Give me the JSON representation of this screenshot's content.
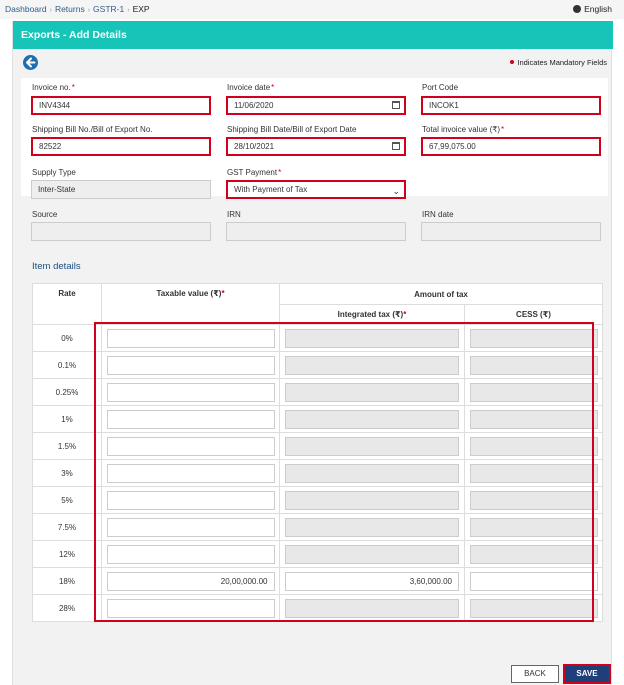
{
  "breadcrumb": {
    "items": [
      "Dashboard",
      "Returns",
      "GSTR-1"
    ],
    "current": "EXP"
  },
  "language": "English",
  "header": {
    "title": "Exports - Add Details"
  },
  "mandatory_note": "Indicates Mandatory Fields",
  "form": {
    "invoice_no": {
      "label": "Invoice no.",
      "value": "INV4344"
    },
    "invoice_date": {
      "label": "Invoice date",
      "value": "11/06/2020"
    },
    "port_code": {
      "label": "Port Code",
      "value": "INCOK1"
    },
    "shipping_bill_no": {
      "label": "Shipping Bill No./Bill of Export No.",
      "value": "82522"
    },
    "shipping_bill_date": {
      "label": "Shipping Bill Date/Bill of Export Date",
      "value": "28/10/2021"
    },
    "total_invoice_value": {
      "label": "Total invoice value (₹)",
      "value": "67,99,075.00"
    },
    "supply_type": {
      "label": "Supply Type",
      "value": "Inter-State"
    },
    "gst_payment": {
      "label": "GST Payment",
      "value": "With Payment of Tax"
    },
    "source": {
      "label": "Source",
      "value": ""
    },
    "irn": {
      "label": "IRN",
      "value": ""
    },
    "irn_date": {
      "label": "IRN date",
      "value": ""
    }
  },
  "items": {
    "title": "Item details",
    "headers": {
      "rate": "Rate",
      "taxable": "Taxable value (₹)",
      "amount_of_tax": "Amount of tax",
      "igst": "Integrated tax (₹)",
      "cess": "CESS (₹)"
    },
    "rows": [
      {
        "rate": "0%",
        "taxable": "",
        "igst": "",
        "cess": ""
      },
      {
        "rate": "0.1%",
        "taxable": "",
        "igst": "",
        "cess": ""
      },
      {
        "rate": "0.25%",
        "taxable": "",
        "igst": "",
        "cess": ""
      },
      {
        "rate": "1%",
        "taxable": "",
        "igst": "",
        "cess": ""
      },
      {
        "rate": "1.5%",
        "taxable": "",
        "igst": "",
        "cess": ""
      },
      {
        "rate": "3%",
        "taxable": "",
        "igst": "",
        "cess": ""
      },
      {
        "rate": "5%",
        "taxable": "",
        "igst": "",
        "cess": ""
      },
      {
        "rate": "7.5%",
        "taxable": "",
        "igst": "",
        "cess": ""
      },
      {
        "rate": "12%",
        "taxable": "",
        "igst": "",
        "cess": ""
      },
      {
        "rate": "18%",
        "taxable": "20,00,000.00",
        "igst": "3,60,000.00",
        "cess": ""
      },
      {
        "rate": "28%",
        "taxable": "",
        "igst": "",
        "cess": ""
      }
    ]
  },
  "buttons": {
    "back": "BACK",
    "save": "SAVE"
  },
  "colors": {
    "header": "#17c4b8",
    "highlight": "#d0021b",
    "save": "#1f3f7a",
    "link": "#2f5d8a"
  }
}
